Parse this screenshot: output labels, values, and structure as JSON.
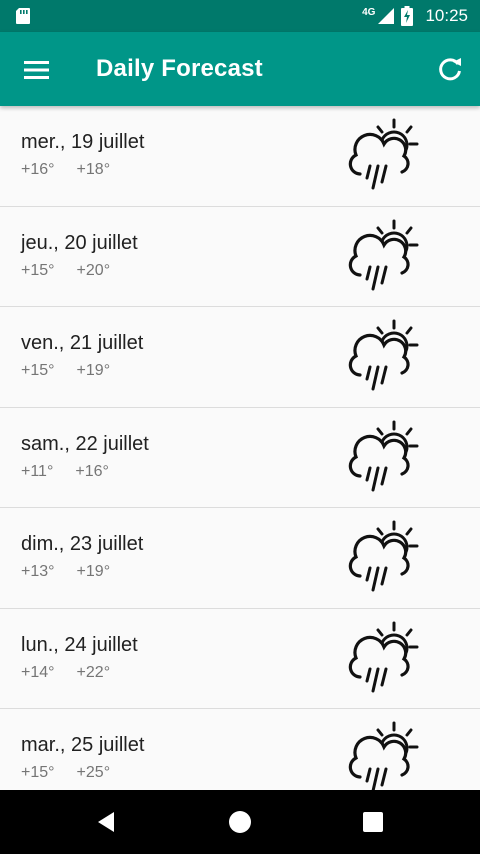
{
  "status_bar": {
    "network": "4G",
    "time": "10:25"
  },
  "app_bar": {
    "title": "Daily Forecast",
    "menu_icon": "hamburger-menu-icon",
    "refresh_icon": "refresh-icon"
  },
  "forecast": [
    {
      "date": "mer., 19 juillet",
      "temp_min": "+16°",
      "temp_max": "+18°",
      "icon": "partly-sunny-rain-icon"
    },
    {
      "date": "jeu., 20 juillet",
      "temp_min": "+15°",
      "temp_max": "+20°",
      "icon": "partly-sunny-rain-icon"
    },
    {
      "date": "ven., 21 juillet",
      "temp_min": "+15°",
      "temp_max": "+19°",
      "icon": "partly-sunny-rain-icon"
    },
    {
      "date": "sam., 22 juillet",
      "temp_min": "+11°",
      "temp_max": "+16°",
      "icon": "partly-sunny-rain-icon"
    },
    {
      "date": "dim., 23 juillet",
      "temp_min": "+13°",
      "temp_max": "+19°",
      "icon": "partly-sunny-rain-icon"
    },
    {
      "date": "lun., 24 juillet",
      "temp_min": "+14°",
      "temp_max": "+22°",
      "icon": "partly-sunny-rain-icon"
    },
    {
      "date": "mar., 25 juillet",
      "temp_min": "+15°",
      "temp_max": "+25°",
      "icon": "partly-sunny-rain-icon"
    }
  ],
  "nav_bar": {
    "back_icon": "back-triangle-icon",
    "home_icon": "home-circle-icon",
    "recents_icon": "recents-square-icon"
  },
  "colors": {
    "status_bar": "#00796b",
    "app_bar": "#009688",
    "primary_text": "#212121",
    "secondary_text": "#757575"
  }
}
